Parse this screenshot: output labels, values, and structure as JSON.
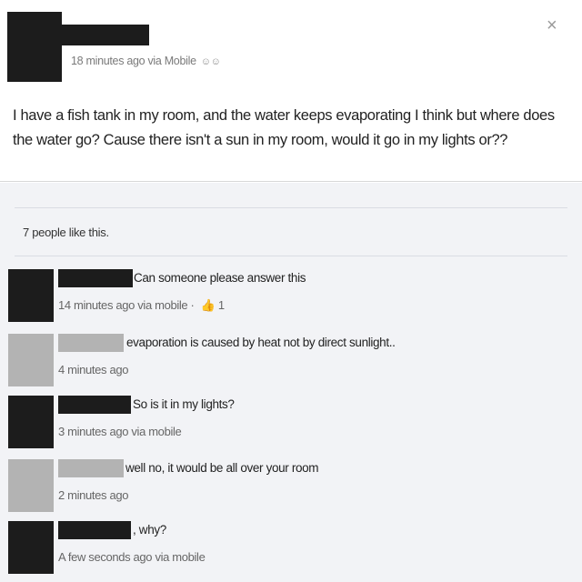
{
  "post": {
    "meta": "18 minutes ago via Mobile",
    "audience_icon": "people-icon",
    "close_icon": "×",
    "text": "I have a fish tank in my room, and the water keeps evaporating I think but where does the water go? Cause there isn't a sun in my room, would it go in my lights or??"
  },
  "likes": {
    "text": "7 people like this."
  },
  "comments": [
    {
      "text": "Can someone please answer this",
      "meta": "14 minutes ago via mobile · ",
      "like_icon": "thumbs-up-icon",
      "like_count": "1"
    },
    {
      "text": "evaporation is caused by heat not by direct sunlight..",
      "meta": "4 minutes ago"
    },
    {
      "text": "So is it in my lights?",
      "meta": "3 minutes ago via mobile"
    },
    {
      "text": "well no, it would be all over your room",
      "meta": "2 minutes ago"
    },
    {
      "text": ", why?",
      "meta": "A few seconds ago via mobile"
    }
  ],
  "colors": {
    "redaction_dark": "#1c1c1c",
    "redaction_light": "#b3b3b3",
    "feedback_bg": "#f2f3f6"
  }
}
